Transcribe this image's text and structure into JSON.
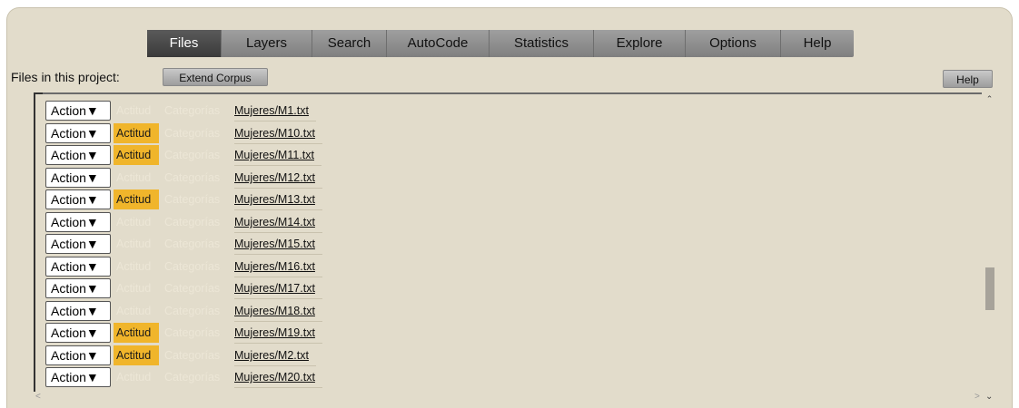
{
  "tabs": [
    {
      "label": "Files",
      "active": true
    },
    {
      "label": "Layers",
      "active": false
    },
    {
      "label": "Search",
      "active": false
    },
    {
      "label": "AutoCode",
      "active": false
    },
    {
      "label": "Statistics",
      "active": false
    },
    {
      "label": "Explore",
      "active": false
    },
    {
      "label": "Options",
      "active": false
    },
    {
      "label": "Help",
      "active": false
    }
  ],
  "files_label": "Files in this project:",
  "extend_corpus_label": "Extend Corpus",
  "help_button_label": "Help",
  "action_label": "Action▼",
  "actitud_label": "Actitud",
  "categorias_label": "Categorías",
  "files": [
    {
      "name": "Mujeres/M1.txt",
      "actitud_highlight": false
    },
    {
      "name": "Mujeres/M10.txt",
      "actitud_highlight": true
    },
    {
      "name": "Mujeres/M11.txt",
      "actitud_highlight": true
    },
    {
      "name": "Mujeres/M12.txt",
      "actitud_highlight": false
    },
    {
      "name": "Mujeres/M13.txt",
      "actitud_highlight": true
    },
    {
      "name": "Mujeres/M14.txt",
      "actitud_highlight": false
    },
    {
      "name": "Mujeres/M15.txt",
      "actitud_highlight": false
    },
    {
      "name": "Mujeres/M16.txt",
      "actitud_highlight": false
    },
    {
      "name": "Mujeres/M17.txt",
      "actitud_highlight": false
    },
    {
      "name": "Mujeres/M18.txt",
      "actitud_highlight": false
    },
    {
      "name": "Mujeres/M19.txt",
      "actitud_highlight": true
    },
    {
      "name": "Mujeres/M2.txt",
      "actitud_highlight": true
    },
    {
      "name": "Mujeres/M20.txt",
      "actitud_highlight": false
    }
  ],
  "colors": {
    "panel_bg": "#e2dccb",
    "highlight": "#f0b52b",
    "active_tab": "#4a4a4a"
  },
  "icons": {
    "scroll_up": "chevron-up-icon",
    "scroll_down": "chevron-down-icon",
    "scroll_left": "chevron-left-icon",
    "scroll_right": "chevron-right-icon"
  }
}
